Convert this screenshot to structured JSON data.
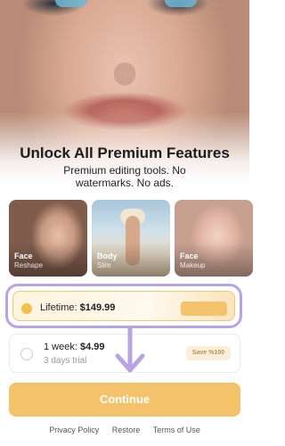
{
  "paywall": {
    "title": "Unlock All Premium Features",
    "subtitle": "Premium editing tools. No watermarks. No ads."
  },
  "features": [
    {
      "label": "Face",
      "sub": "Reshape"
    },
    {
      "label": "Body",
      "sub": "Slim"
    },
    {
      "label": "Face",
      "sub": "Makeup"
    }
  ],
  "plans": {
    "lifetime": {
      "name": "Lifetime:",
      "price": "$149.99",
      "selected": true
    },
    "week": {
      "name": "1 week:",
      "price": "$4.99",
      "trial": "3 days trial",
      "badge": "Save %100"
    }
  },
  "continue_label": "Continue",
  "footer": {
    "privacy": "Privacy Policy",
    "restore": "Restore",
    "terms": "Terms of Use"
  },
  "colors": {
    "accent": "#f3c26a",
    "highlight": "#b9a4e3",
    "radio_selected": "#f3bf4b"
  }
}
